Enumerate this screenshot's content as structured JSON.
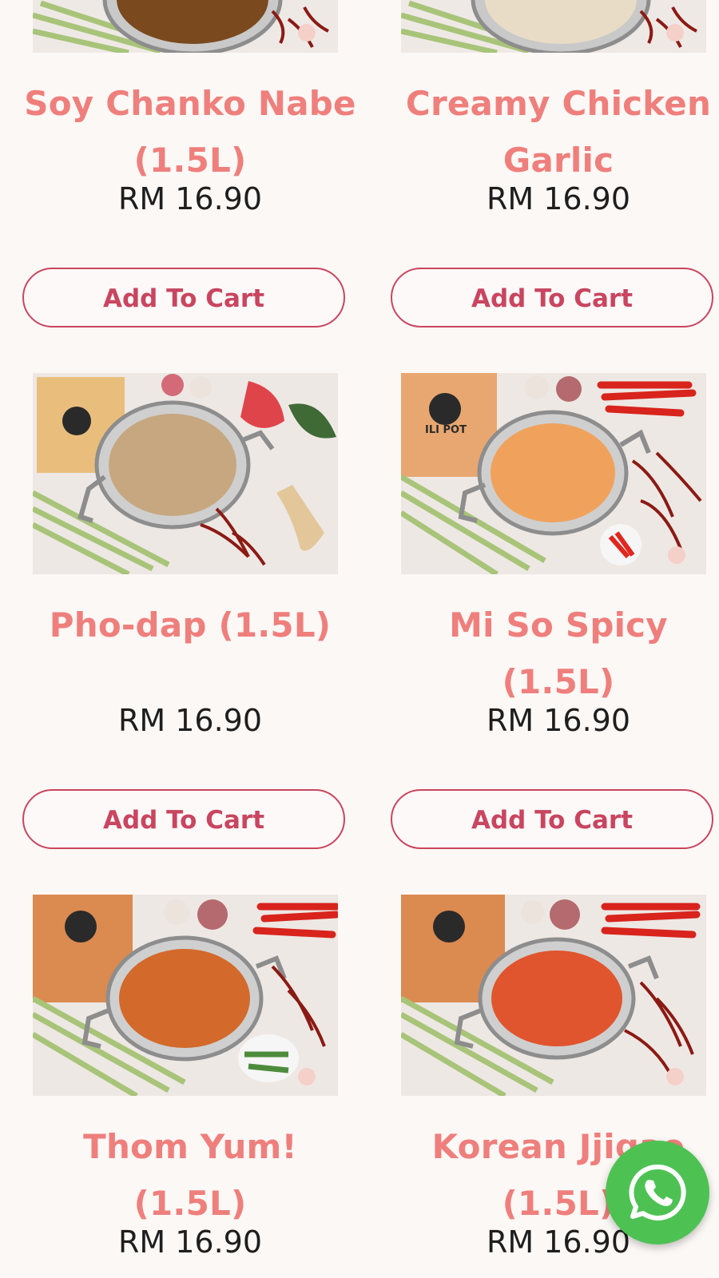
{
  "products": [
    {
      "name": "Soy Chanko Nabe (1.5L)",
      "price": "RM 16.90",
      "button": "Add To Cart",
      "soup_color": "#7a4a1e"
    },
    {
      "name": "Creamy Chicken Garlic",
      "price": "RM 16.90",
      "button": "Add To Cart",
      "soup_color": "#e9dcc6"
    },
    {
      "name": "Pho-dap (1.5L)",
      "price": "RM 16.90",
      "button": "Add To Cart",
      "soup_color": "#c7a780"
    },
    {
      "name": "Mi So Spicy (1.5L)",
      "price": "RM 16.90",
      "button": "Add To Cart",
      "soup_color": "#f0a25c"
    },
    {
      "name": "Thom Yum! (1.5L)",
      "price": "RM 16.90",
      "button": "Add To Cart",
      "soup_color": "#d3692a"
    },
    {
      "name": "Korean Jjigae (1.5L)",
      "price": "RM 16.90",
      "button": "Add To Cart",
      "soup_color": "#e0552d"
    }
  ],
  "bag_label": "ILI POT",
  "whatsapp": {
    "icon": "whatsapp-icon",
    "color": "#4dc253"
  },
  "colors": {
    "title": "#ef7f7c",
    "button": "#c94560",
    "price": "#1e1e1e",
    "background": "#fcf8f6"
  }
}
